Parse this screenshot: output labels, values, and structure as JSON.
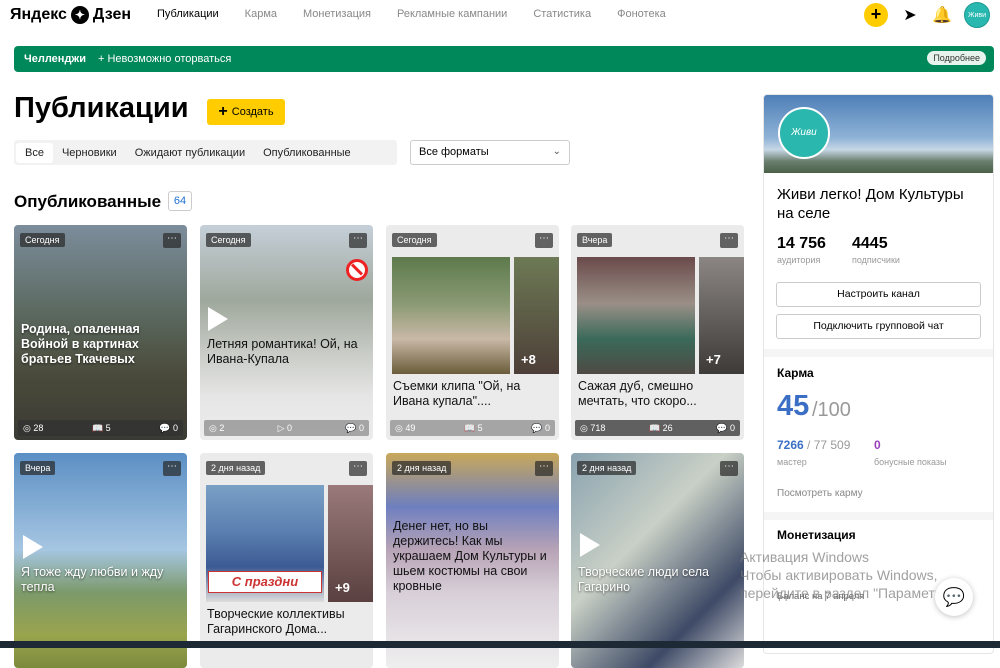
{
  "header": {
    "logo_text": "Яндекс",
    "logo_text2": "Дзен",
    "nav": [
      "Публикации",
      "Карма",
      "Монетизация",
      "Рекламные кампании",
      "Статистика",
      "Фонотека"
    ],
    "avatar_text": "Живи легко"
  },
  "banner": {
    "label": "Челленджи",
    "text": "+ Невозможно оторваться",
    "more": "Подробнее"
  },
  "page": {
    "title": "Публикации",
    "create_label": "Создать",
    "tabs": [
      "Все",
      "Черновики",
      "Ожидают публикации",
      "Опубликованные"
    ],
    "format_select": "Все форматы",
    "section_title": "Опубликованные",
    "count": "64"
  },
  "cards": [
    {
      "date": "Сегодня",
      "title": "Родина, опаленная Войной в картинах братьев Ткачевых",
      "s1": "28",
      "s2": "5",
      "s3": "0"
    },
    {
      "date": "Сегодня",
      "title": "Летняя романтика! Ой, на Ивана-Купала",
      "s1": "2",
      "s2": "0",
      "s3": "0"
    },
    {
      "date": "Сегодня",
      "title": "Съемки клипа \"Ой, на Ивана купала\"....",
      "s1": "49",
      "s2": "5",
      "s3": "0",
      "more": "+8"
    },
    {
      "date": "Вчера",
      "title": "Сажая дуб, смешно мечтать, что скоро...",
      "s1": "718",
      "s2": "26",
      "s3": "0",
      "more": "+7"
    },
    {
      "date": "Вчера",
      "title": "Я тоже жду любви и жду тепла"
    },
    {
      "date": "2 дня назад",
      "title": "Творческие коллективы Гагаринского Дома...",
      "more": "+9",
      "banner_text": "С праздни"
    },
    {
      "date": "2 дня назад",
      "title": "Денег нет, но вы держитесь! Как мы украшаем Дом Культуры и шьем костюмы на свои кровные"
    },
    {
      "date": "2 дня назад",
      "title": "Творческие люди села Гагарино"
    }
  ],
  "sidebar": {
    "channel_name": "Живи легко! Дом Культуры на селе",
    "cover_text": "Живи легко!",
    "audience": "14 756",
    "audience_label": "аудитория",
    "subscribers": "4445",
    "subscribers_label": "подписчики",
    "setup_button": "Настроить канал",
    "group_chat_button": "Подключить групповой чат",
    "karma_title": "Карма",
    "karma_value": "45",
    "karma_max": "/100",
    "master_value": "7266",
    "master_total": " / 77 509",
    "master_label": "мастер",
    "bonus_value": "0",
    "bonus_label": "бонусные показы",
    "see_karma": "Посмотреть карму",
    "monet_title": "Монетизация",
    "balance": "Баланс на 7 апреля"
  },
  "watermark": {
    "line1": "Активация Windows",
    "line2": "Чтобы активировать Windows,",
    "line3": "перейдите в раздел \"Параметры\"."
  },
  "colors": {
    "accent": "#ffcc00",
    "banner": "#00875a",
    "link": "#3a6fc5"
  }
}
